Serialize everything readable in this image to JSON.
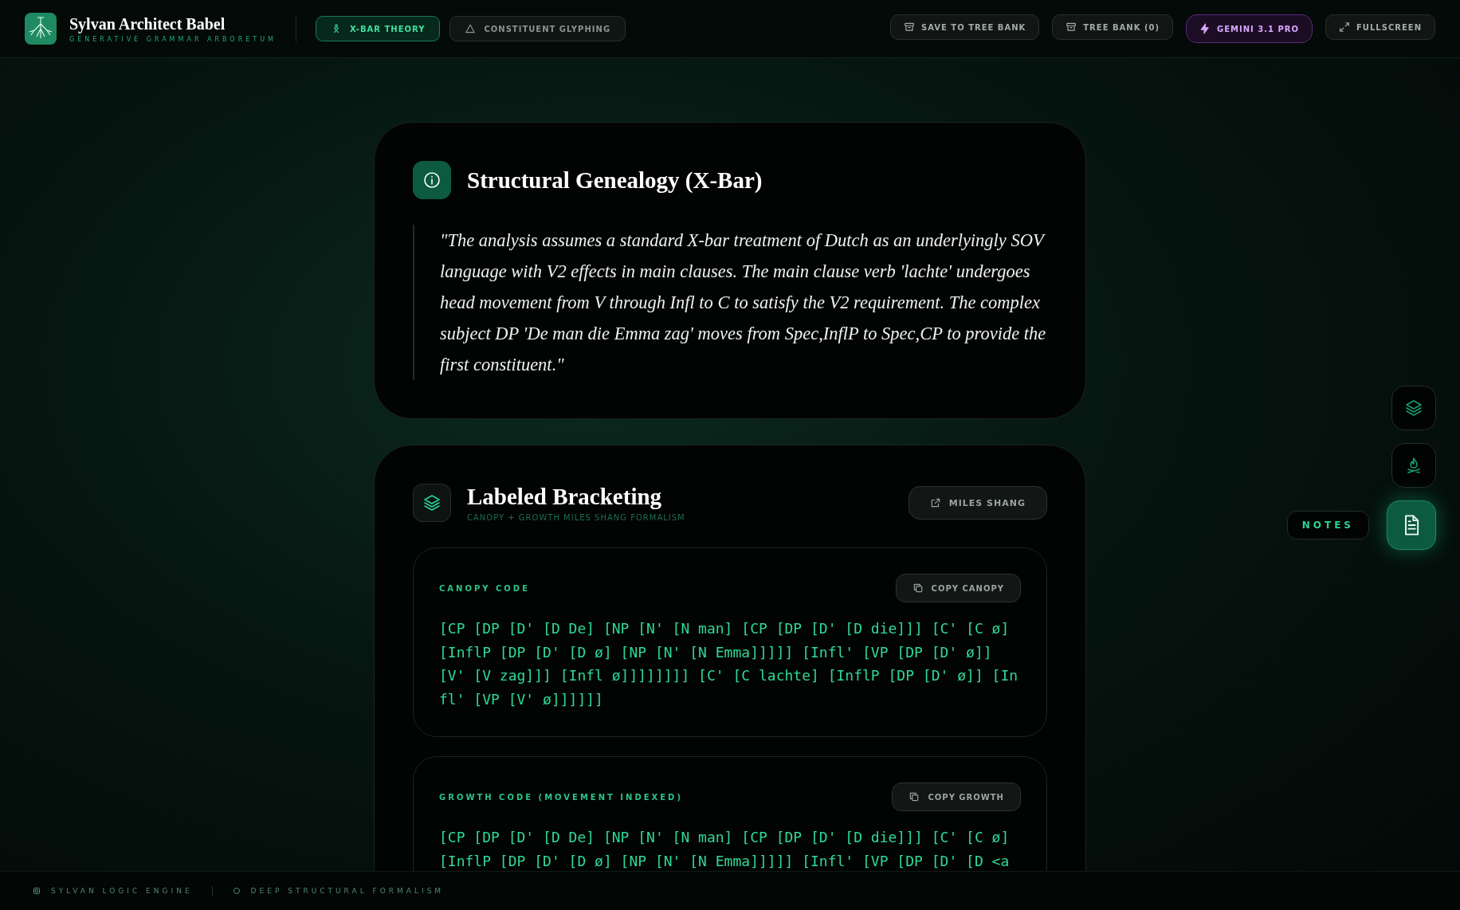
{
  "header": {
    "title": "Sylvan Architect Babel",
    "subtitle": "GENERATIVE GRAMMAR ARBORETUM",
    "tabs": [
      {
        "label": "X-BAR THEORY",
        "kind": "xbar",
        "selected": true
      },
      {
        "label": "CONSTITUENT GLYPHING",
        "kind": "triangle",
        "selected": false
      }
    ],
    "actions": [
      {
        "label": "SAVE TO TREE BANK",
        "kind": "archive"
      },
      {
        "label": "TREE BANK (0)",
        "kind": "archive"
      },
      {
        "label": "GEMINI 3.1 PRO",
        "kind": "model"
      },
      {
        "label": "FULLSCREEN",
        "kind": "expand"
      }
    ]
  },
  "notes": {
    "title": "Structural Genealogy (X-Bar)",
    "quote": "\"The analysis assumes a standard X-bar treatment of Dutch as an underlyingly SOV language with V2 effects in main clauses. The main clause verb 'lachte' undergoes head movement from V through Infl to C to satisfy the V2 requirement. The complex subject DP 'De man die Emma zag' moves from Spec,InflP to Spec,CP to provide the first constituent.\""
  },
  "bracketing": {
    "title": "Labeled Bracketing",
    "subtitle": "CANOPY + GROWTH MILES SHANG FORMALISM",
    "link": "MILES SHANG",
    "blocks": [
      {
        "label": "CANOPY CODE",
        "button": "COPY CANOPY",
        "code": "[CP [DP [D' [D De] [NP [N' [N man] [CP [DP [D' [D die]]] [C' [C ø] [InflP [DP [D' [D ø] [NP [N' [N Emma]]]]] [Infl' [VP [DP [D' ø]] [V' [V zag]]] [Infl ø]]]]]]]] [C' [C lachte] [InflP [DP [D' ø]] [Infl' [VP [V' ø]]]]]]"
      },
      {
        "label": "GROWTH CODE (MOVEMENT INDEXED)",
        "button": "COPY GROWTH",
        "code": "[CP [DP [D' [D De] [NP [N' [N man] [CP [DP [D' [D die]]] [C' [C ø] [InflP [DP [D' [D ø] [NP [N' [N Emma]]]]] [Infl' [VP [DP [D' [D <a"
      }
    ]
  },
  "side_rail": [
    {
      "kind": "layers",
      "selected": false
    },
    {
      "kind": "flame",
      "selected": false
    },
    {
      "kind": "document",
      "selected": true,
      "tooltip": "NOTES"
    }
  ],
  "footer": [
    {
      "kind": "chip",
      "label": "SYLVAN LOGIC ENGINE"
    },
    {
      "kind": "ring",
      "label": "DEEP STRUCTURAL FORMALISM"
    }
  ]
}
